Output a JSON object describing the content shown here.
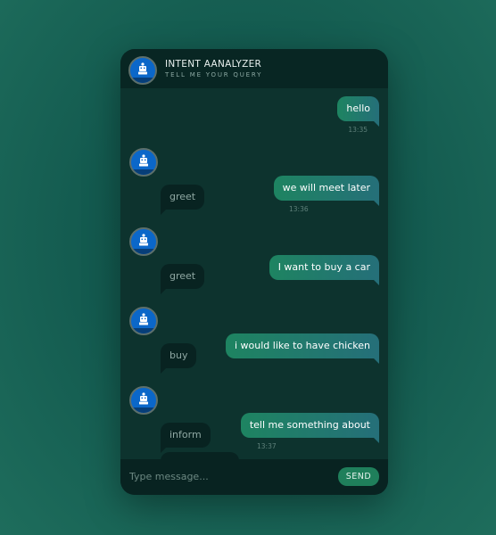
{
  "header": {
    "title": "INTENT AANALYZER",
    "subtitle": "TELL ME YOUR QUERY",
    "avatar_icon": "robot-icon"
  },
  "messages": [
    {
      "sender": "user",
      "text": "hello",
      "time": "13:35"
    },
    {
      "sender": "bot",
      "text": "greet"
    },
    {
      "sender": "user",
      "text": "we will meet later",
      "time": "13:36"
    },
    {
      "sender": "bot",
      "text": "greet"
    },
    {
      "sender": "user",
      "text": "I want to buy a car"
    },
    {
      "sender": "bot",
      "text": "buy"
    },
    {
      "sender": "user",
      "text": "i would like to have chicken"
    },
    {
      "sender": "bot",
      "text": "inform"
    },
    {
      "sender": "user",
      "text": "tell me something about",
      "time": "13:37"
    }
  ],
  "composer": {
    "placeholder": "Type message...",
    "send_label": "SEND"
  },
  "colors": {
    "user_bubble_start": "#1e8461",
    "user_bubble_end": "#256f79",
    "bot_bubble": "#082321",
    "avatar": "#0b67c9",
    "send_button": "#1f7f5b"
  }
}
